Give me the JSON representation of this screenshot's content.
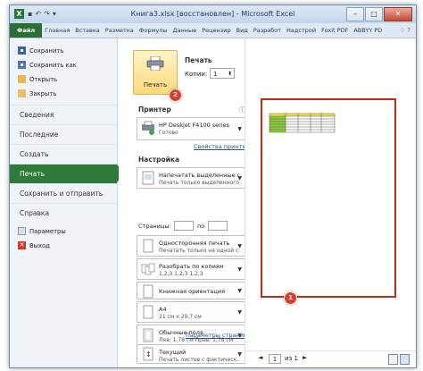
{
  "window": {
    "title": "Книга3.xlsx [восстановлен] - Microsoft Excel",
    "minimize": "–",
    "maximize": "□",
    "close": "✕"
  },
  "ribbon_tabs": [
    "Файл",
    "Главная",
    "Вставка",
    "Разметка",
    "Формулы",
    "Данные",
    "Рецензир",
    "Вид",
    "Разработ",
    "Надстрой",
    "Foxit PDF",
    "ABBYY PD"
  ],
  "backstage": {
    "top_items": [
      {
        "label": "Сохранить",
        "icon": "save-icon"
      },
      {
        "label": "Сохранить как",
        "icon": "save-as-icon"
      },
      {
        "label": "Открыть",
        "icon": "open-folder-icon"
      },
      {
        "label": "Закрыть",
        "icon": "close-file-icon"
      }
    ],
    "sections": [
      "Сведения",
      "Последние",
      "Создать",
      "Печать",
      "Сохранить и отправить",
      "Справка"
    ],
    "active_section": "Печать",
    "bottom_items": [
      {
        "label": "Параметры",
        "icon": "options-icon"
      },
      {
        "label": "Выход",
        "icon": "exit-icon"
      }
    ]
  },
  "print": {
    "heading": "Печать",
    "button_label": "Печать",
    "copies_label": "Копии:",
    "copies_value": "1",
    "badge_print": "2",
    "printer_heading": "Принтер",
    "printer_name": "HP Deskjet F4100 series",
    "printer_status": "Готово",
    "printer_props_link": "Свойства принтера",
    "settings_heading": "Настройка",
    "what_line1": "Напечатать выделенные фр...",
    "what_line2": "Печать только выделенного ф...",
    "pages_label": "Страницы:",
    "pages_to": "по",
    "sides_line1": "Односторонняя печать",
    "sides_line2": "Печатать только на одной с...",
    "collate_line1": "Разобрать по копиям",
    "collate_line2": "1,2,3   1,2,3   1,2,3",
    "orientation": "Книжная ориентация",
    "paper_line1": "A4",
    "paper_line2": "21 см x 29,7 см",
    "margins_line1": "Обычные поля",
    "margins_line2": "Лев: 1,78 см   Прав: 1,78 см",
    "scaling_line1": "Текущий",
    "scaling_line2": "Печать листов с фактическ...",
    "page_setup_link": "Параметры страницы"
  },
  "preview": {
    "badge_page": "1",
    "current_page": "1",
    "total_pages": "из 1",
    "table_colors": {
      "header": "#f3e24a",
      "label": "#8fcf3c",
      "grid": "#333333"
    }
  }
}
